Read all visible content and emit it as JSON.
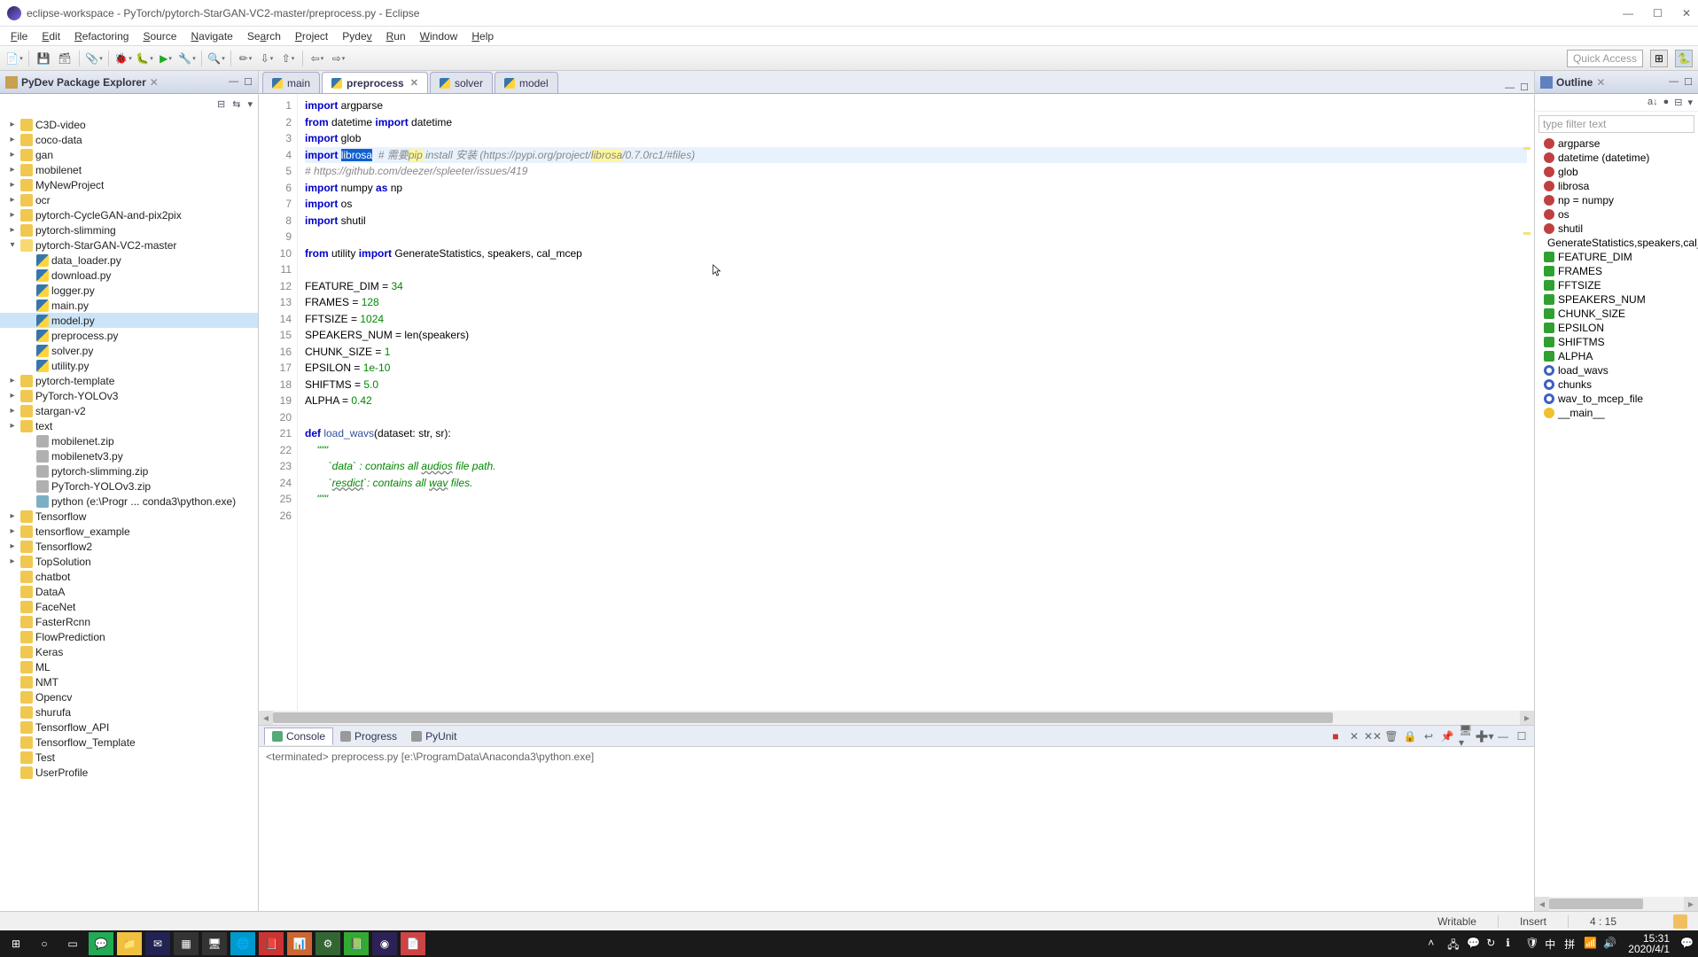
{
  "title": "eclipse-workspace - PyTorch/pytorch-StarGAN-VC2-master/preprocess.py - Eclipse",
  "menu": [
    "File",
    "Edit",
    "Refactoring",
    "Source",
    "Navigate",
    "Search",
    "Project",
    "Pydev",
    "Run",
    "Window",
    "Help"
  ],
  "quick_access": "Quick Access",
  "explorer_title": "PyDev Package Explorer",
  "tree": [
    {
      "l": 0,
      "tw": "▸",
      "icon": "folder",
      "label": "C3D-video"
    },
    {
      "l": 0,
      "tw": "▸",
      "icon": "folder",
      "label": "coco-data"
    },
    {
      "l": 0,
      "tw": "▸",
      "icon": "folder",
      "label": "gan"
    },
    {
      "l": 0,
      "tw": "▸",
      "icon": "folder",
      "label": "mobilenet"
    },
    {
      "l": 0,
      "tw": "▸",
      "icon": "folder",
      "label": "MyNewProject"
    },
    {
      "l": 0,
      "tw": "▸",
      "icon": "folder",
      "label": "ocr"
    },
    {
      "l": 0,
      "tw": "▸",
      "icon": "folder",
      "label": "pytorch-CycleGAN-and-pix2pix"
    },
    {
      "l": 0,
      "tw": "▸",
      "icon": "folder",
      "label": "pytorch-slimming"
    },
    {
      "l": 0,
      "tw": "▾",
      "icon": "folder open",
      "label": "pytorch-StarGAN-VC2-master"
    },
    {
      "l": 1,
      "tw": "",
      "icon": "py",
      "label": "data_loader.py"
    },
    {
      "l": 1,
      "tw": "",
      "icon": "py",
      "label": "download.py"
    },
    {
      "l": 1,
      "tw": "",
      "icon": "py",
      "label": "logger.py"
    },
    {
      "l": 1,
      "tw": "",
      "icon": "py",
      "label": "main.py"
    },
    {
      "l": 1,
      "tw": "",
      "icon": "py",
      "label": "model.py",
      "sel": true
    },
    {
      "l": 1,
      "tw": "",
      "icon": "py",
      "label": "preprocess.py"
    },
    {
      "l": 1,
      "tw": "",
      "icon": "py",
      "label": "solver.py"
    },
    {
      "l": 1,
      "tw": "",
      "icon": "py",
      "label": "utility.py"
    },
    {
      "l": 0,
      "tw": "▸",
      "icon": "folder",
      "label": "pytorch-template"
    },
    {
      "l": 0,
      "tw": "▸",
      "icon": "folder",
      "label": "PyTorch-YOLOv3"
    },
    {
      "l": 0,
      "tw": "▸",
      "icon": "folder",
      "label": "stargan-v2"
    },
    {
      "l": 0,
      "tw": "▸",
      "icon": "folder",
      "label": "text"
    },
    {
      "l": 1,
      "tw": "",
      "icon": "zip",
      "label": "mobilenet.zip"
    },
    {
      "l": 1,
      "tw": "",
      "icon": "zip",
      "label": "mobilenetv3.py"
    },
    {
      "l": 1,
      "tw": "",
      "icon": "zip",
      "label": "pytorch-slimming.zip"
    },
    {
      "l": 1,
      "tw": "",
      "icon": "zip",
      "label": "PyTorch-YOLOv3.zip"
    },
    {
      "l": 1,
      "tw": "",
      "icon": "exe",
      "label": "python  (e:\\Progr ... conda3\\python.exe)"
    },
    {
      "l": 0,
      "tw": "▸",
      "icon": "folder",
      "label": "Tensorflow"
    },
    {
      "l": 0,
      "tw": "▸",
      "icon": "folder",
      "label": "tensorflow_example"
    },
    {
      "l": 0,
      "tw": "▸",
      "icon": "folder",
      "label": "Tensorflow2"
    },
    {
      "l": 0,
      "tw": "▸",
      "icon": "folder",
      "label": "TopSolution"
    },
    {
      "l": 0,
      "tw": "",
      "icon": "folder",
      "label": "chatbot"
    },
    {
      "l": 0,
      "tw": "",
      "icon": "folder",
      "label": "DataA"
    },
    {
      "l": 0,
      "tw": "",
      "icon": "folder",
      "label": "FaceNet"
    },
    {
      "l": 0,
      "tw": "",
      "icon": "folder",
      "label": "FasterRcnn"
    },
    {
      "l": 0,
      "tw": "",
      "icon": "folder",
      "label": "FlowPrediction"
    },
    {
      "l": 0,
      "tw": "",
      "icon": "folder",
      "label": "Keras"
    },
    {
      "l": 0,
      "tw": "",
      "icon": "folder",
      "label": "ML"
    },
    {
      "l": 0,
      "tw": "",
      "icon": "folder",
      "label": "NMT"
    },
    {
      "l": 0,
      "tw": "",
      "icon": "folder",
      "label": "Opencv"
    },
    {
      "l": 0,
      "tw": "",
      "icon": "folder",
      "label": "shurufa"
    },
    {
      "l": 0,
      "tw": "",
      "icon": "folder",
      "label": "Tensorflow_API"
    },
    {
      "l": 0,
      "tw": "",
      "icon": "folder",
      "label": "Tensorflow_Template"
    },
    {
      "l": 0,
      "tw": "",
      "icon": "folder",
      "label": "Test"
    },
    {
      "l": 0,
      "tw": "",
      "icon": "folder",
      "label": "UserProfile"
    }
  ],
  "tabs": [
    {
      "label": "main",
      "active": false
    },
    {
      "label": "preprocess",
      "active": true
    },
    {
      "label": "solver",
      "active": false
    },
    {
      "label": "model",
      "active": false
    }
  ],
  "code_lines": 26,
  "outline_title": "Outline",
  "outline_filter": "type filter text",
  "outline": [
    {
      "icon": "imp",
      "label": "argparse"
    },
    {
      "icon": "imp",
      "label": "datetime (datetime)"
    },
    {
      "icon": "imp",
      "label": "glob"
    },
    {
      "icon": "imp",
      "label": "librosa"
    },
    {
      "icon": "imp",
      "label": "np = numpy"
    },
    {
      "icon": "imp",
      "label": "os"
    },
    {
      "icon": "imp",
      "label": "shutil"
    },
    {
      "icon": "imp",
      "label": "GenerateStatistics,speakers,cal_mc"
    },
    {
      "icon": "fld",
      "label": "FEATURE_DIM"
    },
    {
      "icon": "fld",
      "label": "FRAMES"
    },
    {
      "icon": "fld",
      "label": "FFTSIZE"
    },
    {
      "icon": "fld",
      "label": "SPEAKERS_NUM"
    },
    {
      "icon": "fld",
      "label": "CHUNK_SIZE"
    },
    {
      "icon": "fld",
      "label": "EPSILON"
    },
    {
      "icon": "fld",
      "label": "SHIFTMS"
    },
    {
      "icon": "fld",
      "label": "ALPHA"
    },
    {
      "icon": "fn",
      "label": "load_wavs"
    },
    {
      "icon": "fn",
      "label": "chunks"
    },
    {
      "icon": "fn",
      "label": "wav_to_mcep_file"
    },
    {
      "icon": "run",
      "label": "__main__"
    }
  ],
  "console_tabs": [
    "Console",
    "Progress",
    "PyUnit"
  ],
  "console_line": "<terminated> preprocess.py [e:\\ProgramData\\Anaconda3\\python.exe]",
  "status": {
    "writable": "Writable",
    "insert": "Insert",
    "pos": "4 : 15"
  },
  "clock": {
    "time": "15:31",
    "date": "2020/4/1"
  }
}
